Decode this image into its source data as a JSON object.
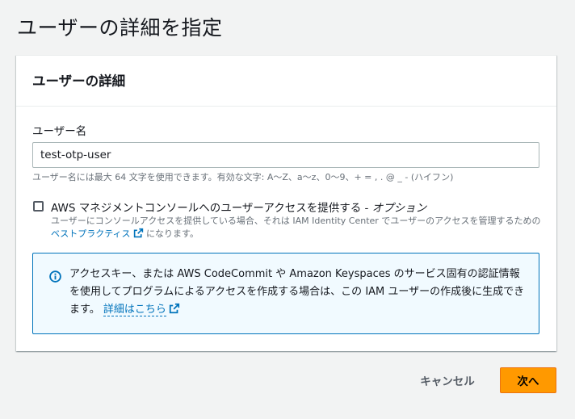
{
  "page": {
    "title": "ユーザーの詳細を指定"
  },
  "panel": {
    "title": "ユーザーの詳細",
    "username": {
      "label": "ユーザー名",
      "value": "test-otp-user",
      "constraint": "ユーザー名には最大 64 文字を使用できます。有効な文字: A〜Z、a〜z、0〜9、+ = , . @ _ - (ハイフン)"
    },
    "console_access": {
      "checked": false,
      "label": "AWS マネジメントコンソールへのユーザーアクセスを提供する - ",
      "label_optional": "オプション",
      "description_before": "ユーザーにコンソールアクセスを提供している場合、それは IAM Identity Center でユーザーのアクセスを管理するための ",
      "description_link": "ベストプラクティス",
      "description_after": " になります。"
    },
    "info": {
      "text": "アクセスキー、または AWS CodeCommit や Amazon Keyspaces のサービス固有の認証情報を使用してプログラムによるアクセスを作成する場合は、この IAM ユーザーの作成後に生成できます。",
      "link": "詳細はこちら"
    }
  },
  "footer": {
    "cancel_label": "キャンセル",
    "next_label": "次へ"
  },
  "colors": {
    "accent": "#ff9900",
    "link": "#0073bb",
    "info_bg": "#f1faff"
  },
  "icons": [
    "info-icon",
    "external-link-icon"
  ]
}
